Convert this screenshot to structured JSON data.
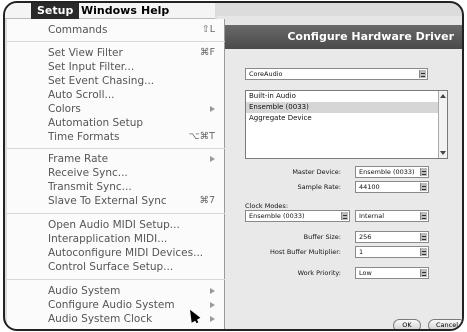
{
  "menubar": {
    "items": [
      {
        "label": "Setup",
        "active": true
      },
      {
        "label": "Windows",
        "active": false
      },
      {
        "label": "Help",
        "active": false
      }
    ]
  },
  "menu": {
    "items": [
      {
        "label": "Commands",
        "shortcut": "⇧L",
        "submenu": false
      },
      {
        "label": "Set View Filter",
        "shortcut": "⌘F",
        "submenu": false
      },
      {
        "label": "Set Input Filter...",
        "shortcut": "",
        "submenu": false
      },
      {
        "label": "Set Event Chasing...",
        "shortcut": "",
        "submenu": false
      },
      {
        "label": "Auto Scroll...",
        "shortcut": "",
        "submenu": false
      },
      {
        "label": "Colors",
        "shortcut": "",
        "submenu": true
      },
      {
        "label": "Automation Setup",
        "shortcut": "",
        "submenu": false
      },
      {
        "label": "Time Formats",
        "shortcut": "⌥⌘T",
        "submenu": false
      },
      {
        "label": "Frame Rate",
        "shortcut": "",
        "submenu": true
      },
      {
        "label": "Receive Sync...",
        "shortcut": "",
        "submenu": false
      },
      {
        "label": "Transmit Sync...",
        "shortcut": "",
        "submenu": false
      },
      {
        "label": "Slave To External Sync",
        "shortcut": "⌘7",
        "submenu": false
      },
      {
        "label": "Open Audio MIDI Setup...",
        "shortcut": "",
        "submenu": false
      },
      {
        "label": "Interapplication MIDI...",
        "shortcut": "",
        "submenu": false
      },
      {
        "label": "Autoconfigure MIDI Devices...",
        "shortcut": "",
        "submenu": false
      },
      {
        "label": "Control Surface Setup...",
        "shortcut": "",
        "submenu": false
      },
      {
        "label": "Audio System",
        "shortcut": "",
        "submenu": true
      },
      {
        "label": "Configure Audio System",
        "shortcut": "",
        "submenu": true
      },
      {
        "label": "Audio System Clock",
        "shortcut": "",
        "submenu": true
      }
    ]
  },
  "dialog": {
    "title": "Configure Hardware Driver",
    "driver": "CoreAudio",
    "devices": [
      "Built-in Audio",
      "Ensemble (0033)",
      "Aggregate Device"
    ],
    "selected_device": "Ensemble (0033)",
    "master_device_label": "Master Device:",
    "master_device": "Ensemble (0033)",
    "sample_rate_label": "Sample Rate:",
    "sample_rate": "44100",
    "clock_modes_label": "Clock Modes:",
    "clock_device": "Ensemble (0033)",
    "clock_mode": "Internal",
    "buffer_size_label": "Buffer Size:",
    "buffer_size": "256",
    "buffer_multiplier_label": "Host Buffer Multiplier:",
    "buffer_multiplier": "1",
    "work_priority_label": "Work Priority:",
    "work_priority": "Low",
    "ok_label": "OK",
    "cancel_label": "Cancel"
  }
}
